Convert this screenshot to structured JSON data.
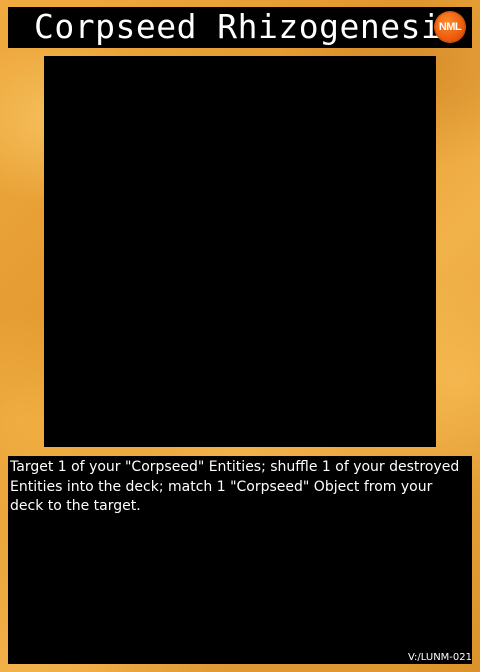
{
  "card": {
    "title": "Corpseed Rhizogenesis",
    "set_badge": "NML",
    "effect_text": "Target 1 of your \"Corpseed\" Entities; shuffle 1 of your destroyed Entities into the deck; match 1 \"Corpseed\" Object from your deck to the target.",
    "card_code": "V:/LUNM-021"
  },
  "colors": {
    "frame": "#e9a23a",
    "panel": "#000000",
    "badge": "#e8560a",
    "text": "#ffffff"
  }
}
